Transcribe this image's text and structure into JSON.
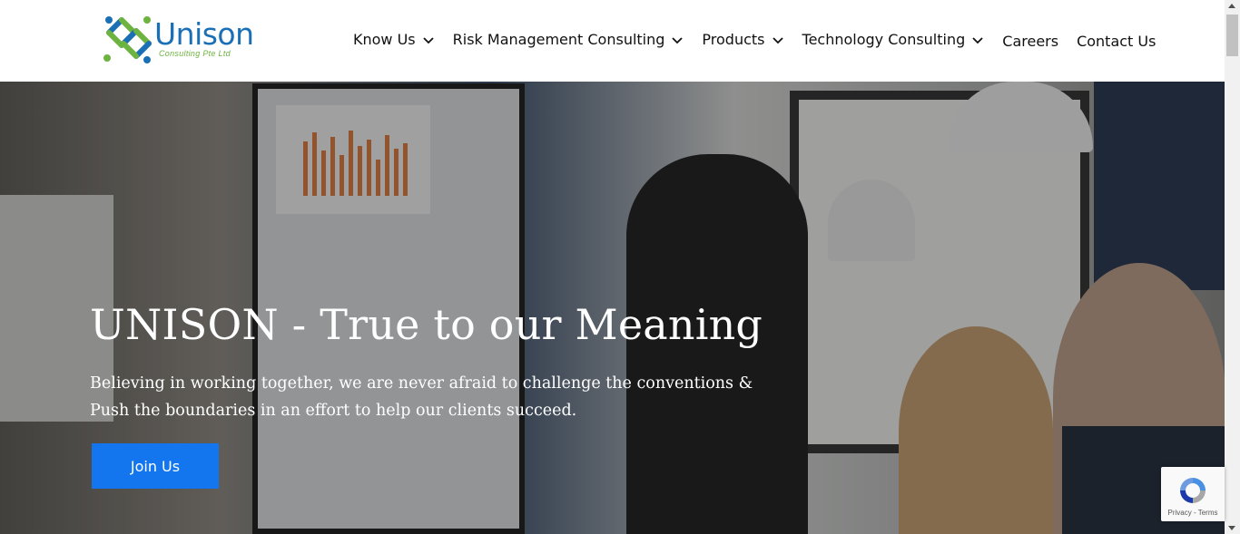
{
  "brand": {
    "name": "Unison",
    "tagline": "Consulting Pte Ltd",
    "colors": {
      "blue": "#1b6fb5",
      "green": "#6db33f"
    }
  },
  "nav": {
    "items": [
      {
        "label": "Know Us",
        "has_dropdown": true
      },
      {
        "label": "Risk Management Consulting",
        "has_dropdown": true
      },
      {
        "label": "Products",
        "has_dropdown": true
      },
      {
        "label": "Technology Consulting",
        "has_dropdown": true
      },
      {
        "label": "Careers",
        "has_dropdown": false
      },
      {
        "label": "Contact Us",
        "has_dropdown": false
      }
    ],
    "dropdown_icon": "chevron-down-icon"
  },
  "hero": {
    "title": "UNISON - True to our Meaning",
    "text_line1": "Believing in working together, we are never afraid to challenge the conventions &",
    "text_line2": "Push the boundaries in an effort to help our clients succeed.",
    "button_label": "Join Us",
    "button_color": "#1376ee"
  },
  "recaptcha": {
    "links": "Privacy - Terms",
    "icon": "recaptcha-icon"
  }
}
